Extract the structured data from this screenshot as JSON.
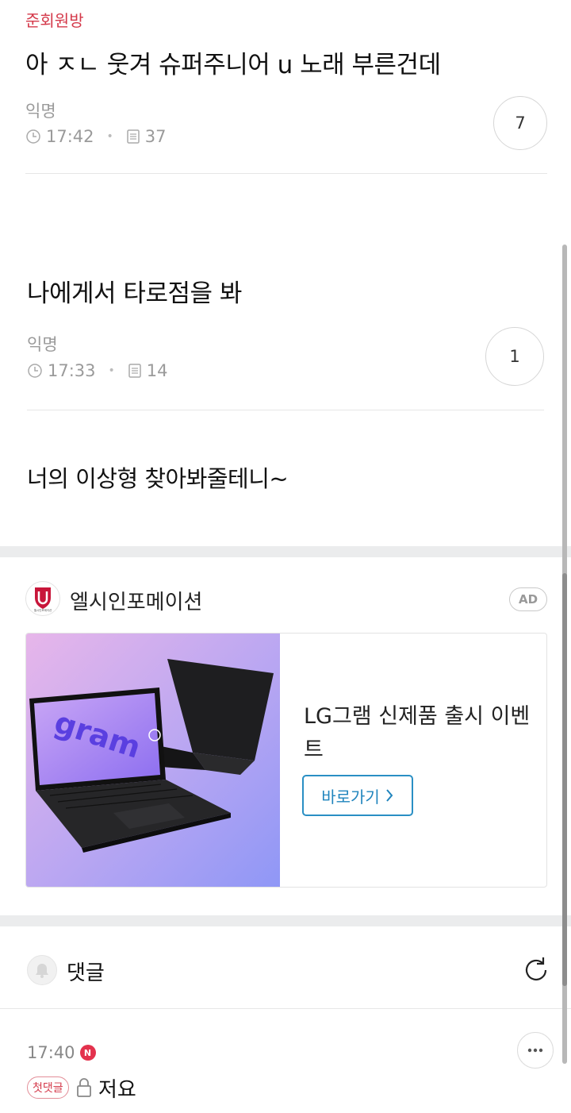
{
  "post1": {
    "board": "준회원방",
    "title": "아 ㅈㄴ 웃겨 슈퍼주니어 u 노래 부른건데",
    "author": "익명",
    "time": "17:42",
    "views": "37",
    "comment_count": "7"
  },
  "post2": {
    "title": "나에게서 타로점을 봐",
    "author": "익명",
    "time": "17:33",
    "views": "14",
    "comment_count": "1",
    "body": "너의 이상형 찾아봐줄테니~"
  },
  "ad": {
    "advertiser": "엘시인포메이션",
    "badge": "AD",
    "logo_caption": "엘시인포메이션",
    "headline": "LG그램 신제품 출시 이벤트",
    "cta_label": "바로가기",
    "cta_icon": "chevron-right-icon",
    "image_text": "gram"
  },
  "comments": {
    "label": "댓글",
    "items": [
      {
        "time": "17:40",
        "new_badge": "N",
        "first_badge": "첫댓글",
        "text": "저요"
      }
    ]
  },
  "colors": {
    "accent_red": "#d4394a",
    "cta_blue": "#1f84bd",
    "meta_gray": "#9a9a9a"
  }
}
